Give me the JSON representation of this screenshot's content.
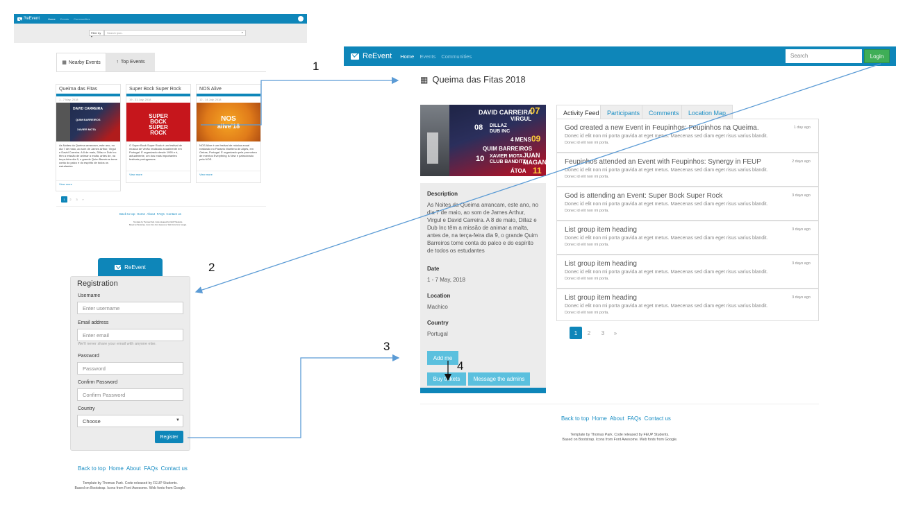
{
  "brand": "ReEvent",
  "nav": {
    "home": "Home",
    "events": "Events",
    "communities": "Communities"
  },
  "search": {
    "filter_label": "Filter by",
    "search_placeholder": "Search ipsn..",
    "top_placeholder": "Search",
    "login": "Login"
  },
  "home": {
    "tabs": [
      "Nearby Events",
      "Top Events"
    ],
    "cards": [
      {
        "title": "Queima das Fitas",
        "date": "1 - 7 May, 2018",
        "text": "As Noites da Queima arrancam, este ano, no dia 7 de maio, ao som de James Arthur, Virgul e David Carreira. A 8 de maio, Dillaz e Dub Inc têm a missão de animar a malta, antes de, na terça-feira dia 9, o grande Quim Barreiros tome conta do palco e do espírito de todos os estudantes",
        "more": "View more"
      },
      {
        "title": "Super Bock Super Rock",
        "date": "19 - 21 July, 2018",
        "text": "O Super Bock Super Rock é um festival de música de Verão realizado anualmente em Portugal. É organizado desde 1995 e é, actualmente, um dos mais importantes festivais portugueses.",
        "more": "View more"
      },
      {
        "title": "NOS Alive",
        "date": "12 - 14 July, 2018",
        "text": "NOS Alive é um festival de música anual realizado no Passeio Marítimo de Algés, em Oeiras, Portugal. É organizado pela promotora de eventos Everything is New e patrocinado pela NOS.",
        "more": "View more"
      }
    ],
    "pages": [
      "1",
      "2",
      "3",
      "»"
    ]
  },
  "footer": {
    "links": [
      "Back to top",
      "Home",
      "About",
      "FAQs",
      "Contact us"
    ],
    "credit1": "Template by Thomas Park. Code released by FEUP Students.",
    "credit2": "Based on Bootstrap. Icons from Font Awesome. Web fonts from Google."
  },
  "registration": {
    "title": "Registration",
    "username_label": "Username",
    "username_ph": "Enter username",
    "email_label": "Email address",
    "email_ph": "Enter email",
    "email_help": "We'll never share your email with anyone else.",
    "password_label": "Password",
    "password_ph": "Password",
    "confirm_label": "Confirm Password",
    "confirm_ph": "Confirm Password",
    "country_label": "Country",
    "country_value": "Choose",
    "register": "Register"
  },
  "event": {
    "title": "Queima das Fitas 2018",
    "tabs": [
      "Activity Feed",
      "Participants",
      "Comments",
      "Location Map"
    ],
    "desc_label": "Description",
    "desc": "As Noites da Queima arrancam, este ano, no dia 7 de maio, ao som de James Arthur, Virgul e David Carreira. A 8 de maio, Dillaz e Dub Inc têm a missão de animar a malta, antes de, na terça-feira dia 9, o grande Quim Barreiros tome conta do palco e do espírito de todos os estudantes",
    "date_label": "Date",
    "date": "1 - 7 May, 2018",
    "location_label": "Location",
    "location": "Machico",
    "country_label": "Country",
    "country": "Portugal",
    "add_me": "Add me",
    "buy": "Buy tickets",
    "message": "Message the admins",
    "feed": [
      {
        "heading": "God created a new Event in Feupinhos: Feupinhos na Queima.",
        "body": "Donec id elit non mi porta gravida at eget metus. Maecenas sed diam eget risus varius blandit.",
        "sub": "Donec id elit non mi porta.",
        "time": "1 day ago"
      },
      {
        "heading": "Feupinhos attended an Event with Feupinhos: Synergy in FEUP",
        "body": "Donec id elit non mi porta gravida at eget metus. Maecenas sed diam eget risus varius blandit.",
        "sub": "Donec id elit non mi porta.",
        "time": "2 days ago"
      },
      {
        "heading": "God is attending an Event: Super Bock Super Rock",
        "body": "Donec id elit non mi porta gravida at eget metus. Maecenas sed diam eget risus varius blandit.",
        "sub": "Donec id elit non mi porta.",
        "time": "3 days ago"
      },
      {
        "heading": "List group item heading",
        "body": "Donec id elit non mi porta gravida at eget metus. Maecenas sed diam eget risus varius blandit.",
        "sub": "Donec id elit non mi porta.",
        "time": "3 days ago"
      },
      {
        "heading": "List group item heading",
        "body": "Donec id elit non mi porta gravida at eget metus. Maecenas sed diam eget risus varius blandit.",
        "sub": "Donec id elit non mi porta.",
        "time": "3 days ago"
      },
      {
        "heading": "List group item heading",
        "body": "Donec id elit non mi porta gravida at eget metus. Maecenas sed diam eget risus varius blandit.",
        "sub": "Donec id elit non mi porta.",
        "time": "3 days ago"
      }
    ],
    "pages": [
      "1",
      "2",
      "3",
      "»"
    ]
  },
  "poster": {
    "l1a": "DAVID CARREIRA",
    "l1b": "07",
    "l1c": "VIRGUL",
    "l2a": "08",
    "l2b": "DILLAZ",
    "l2c": "DUB INC",
    "l3a": "4 MENS",
    "l3b": "09",
    "l4": "QUIM BARREIROS",
    "l5a": "10",
    "l5b": "XAVIER MOTA",
    "l5c": "CLUB BANDITZ",
    "l5d": "JUAN MAGAN",
    "l6": "ÁTOA",
    "l6b": "11"
  },
  "posters_small": {
    "sbsr": [
      "SUPER",
      "BOCK",
      "SUPER",
      "ROCK"
    ],
    "nos": [
      "NOS",
      "alive'18"
    ]
  },
  "annotations": [
    "1",
    "2",
    "3",
    "4"
  ],
  "colors": {
    "primary": "#0e86b9",
    "info": "#5bc0de",
    "success": "#3fae57",
    "arrow": "#5b9bd5"
  }
}
